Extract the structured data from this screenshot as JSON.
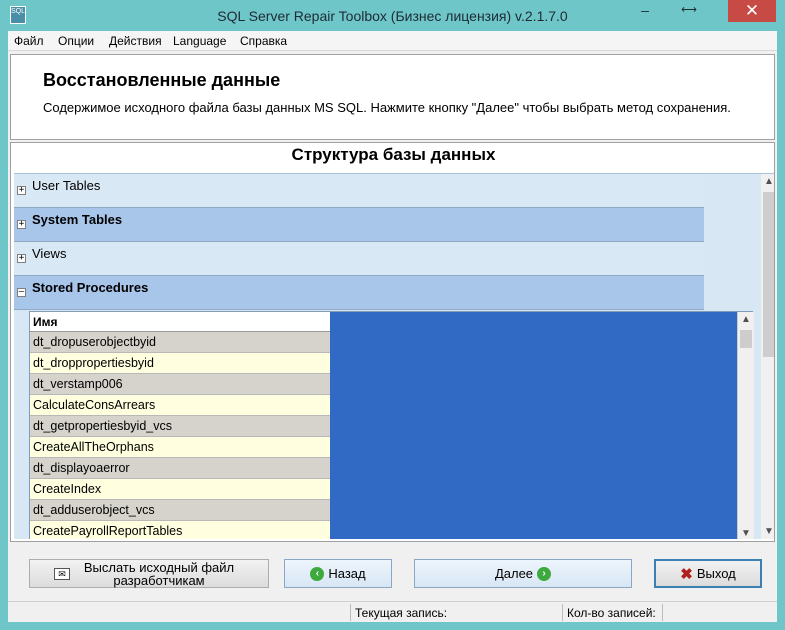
{
  "window": {
    "title": "SQL Server Repair Toolbox (Бизнес лицензия) v.2.1.7.0",
    "minimize": "–",
    "maximize": "⟷",
    "close": "✕",
    "icon_text": "SQL"
  },
  "menu": {
    "items": [
      "Файл",
      "Опции",
      "Действия",
      "Language",
      "Справка"
    ]
  },
  "header": {
    "title": "Восстановленные данные",
    "description": "Содержимое исходного файла базы данных MS SQL. Нажмите кнопку \"Далее\" чтобы выбрать метод сохранения."
  },
  "main": {
    "section_title": "Структура базы данных",
    "groups": [
      {
        "label": "User Tables",
        "expanded": false,
        "expander": "+"
      },
      {
        "label": "System Tables",
        "expanded": false,
        "expander": "+"
      },
      {
        "label": "Views",
        "expanded": false,
        "expander": "+"
      },
      {
        "label": "Stored Procedures",
        "expanded": true,
        "expander": "–"
      }
    ],
    "grid": {
      "column_header": "Имя",
      "rows": [
        "dt_dropuserobjectbyid",
        "dt_droppropertiesbyid",
        "dt_verstamp006",
        "CalculateConsArrears",
        "dt_getpropertiesbyid_vcs",
        "CreateAllTheOrphans",
        "dt_displayoaerror",
        "CreateIndex",
        "dt_adduserobject_vcs",
        "CreatePayrollReportTables"
      ]
    }
  },
  "buttons": {
    "send_label": "Выслать исходный файл разработчикам",
    "back_label": "Назад",
    "next_label": "Далее",
    "exit_label": "Выход"
  },
  "statusbar": {
    "current_record_label": "Текущая запись:",
    "record_count_label": "Кол-во записей:"
  },
  "colors": {
    "titlebar": "#6fc6c9",
    "close_button": "#c74a45",
    "grid_background": "#316ac5",
    "group_dark": "#a8c5ea",
    "group_light": "#d9e8f5"
  }
}
